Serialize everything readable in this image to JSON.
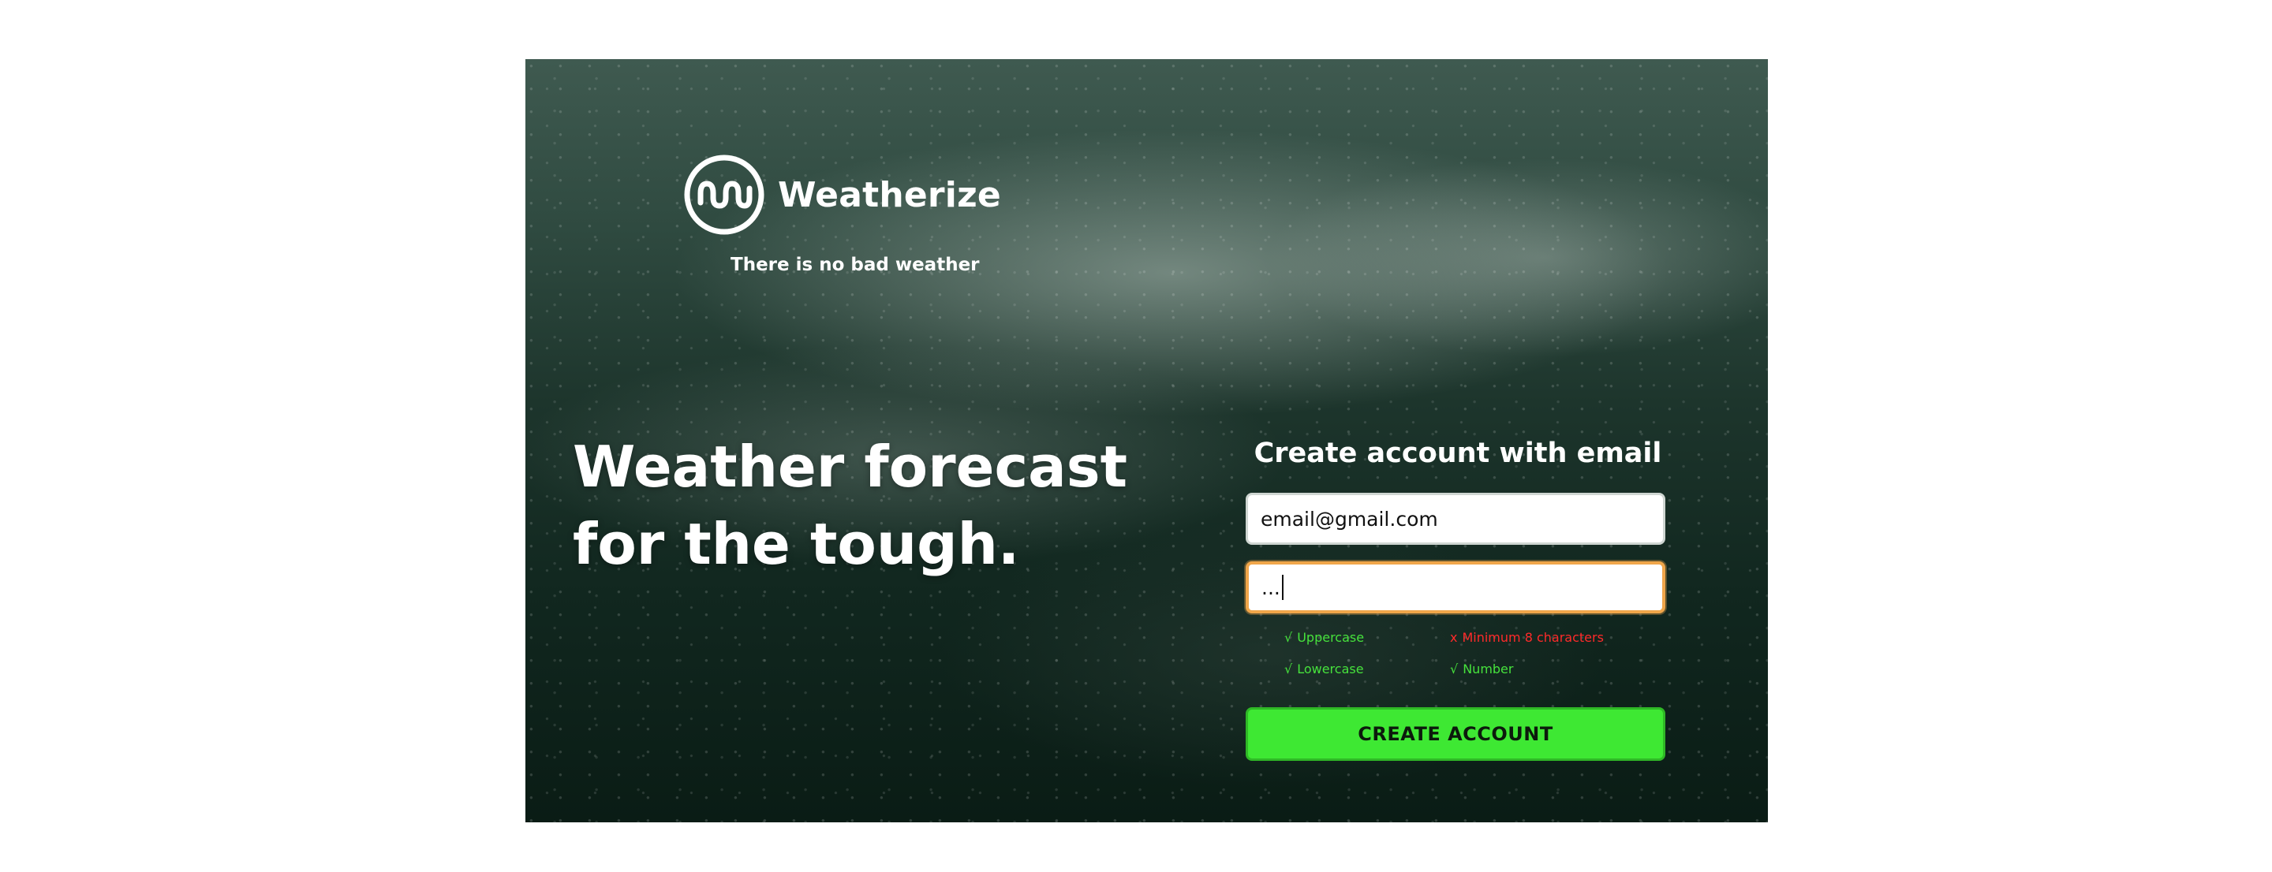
{
  "brand": {
    "name": "Weatherize",
    "tagline": "There is no bad weather",
    "logo_icon": "wave-circle-logo-icon"
  },
  "hero": {
    "line1": "Weather forecast",
    "line2": "for the tough."
  },
  "form": {
    "title": "Create account with email",
    "email_value": "email@gmail.com",
    "password_value": "...",
    "rules": [
      {
        "mark": "√",
        "label": "Uppercase",
        "status": "met"
      },
      {
        "mark": "x",
        "label": "Minimum 8 characters",
        "status": "unmet"
      },
      {
        "mark": "√",
        "label": "Lowercase",
        "status": "met"
      },
      {
        "mark": "√",
        "label": "Number",
        "status": "met"
      }
    ],
    "submit_label": "CREATE ACCOUNT"
  },
  "colors": {
    "accent_green": "#3ee833",
    "rule_ok": "#46e23c",
    "rule_bad": "#ff2a2a",
    "focus_outline": "#f0a64a",
    "background_dark": "#1d352c"
  }
}
